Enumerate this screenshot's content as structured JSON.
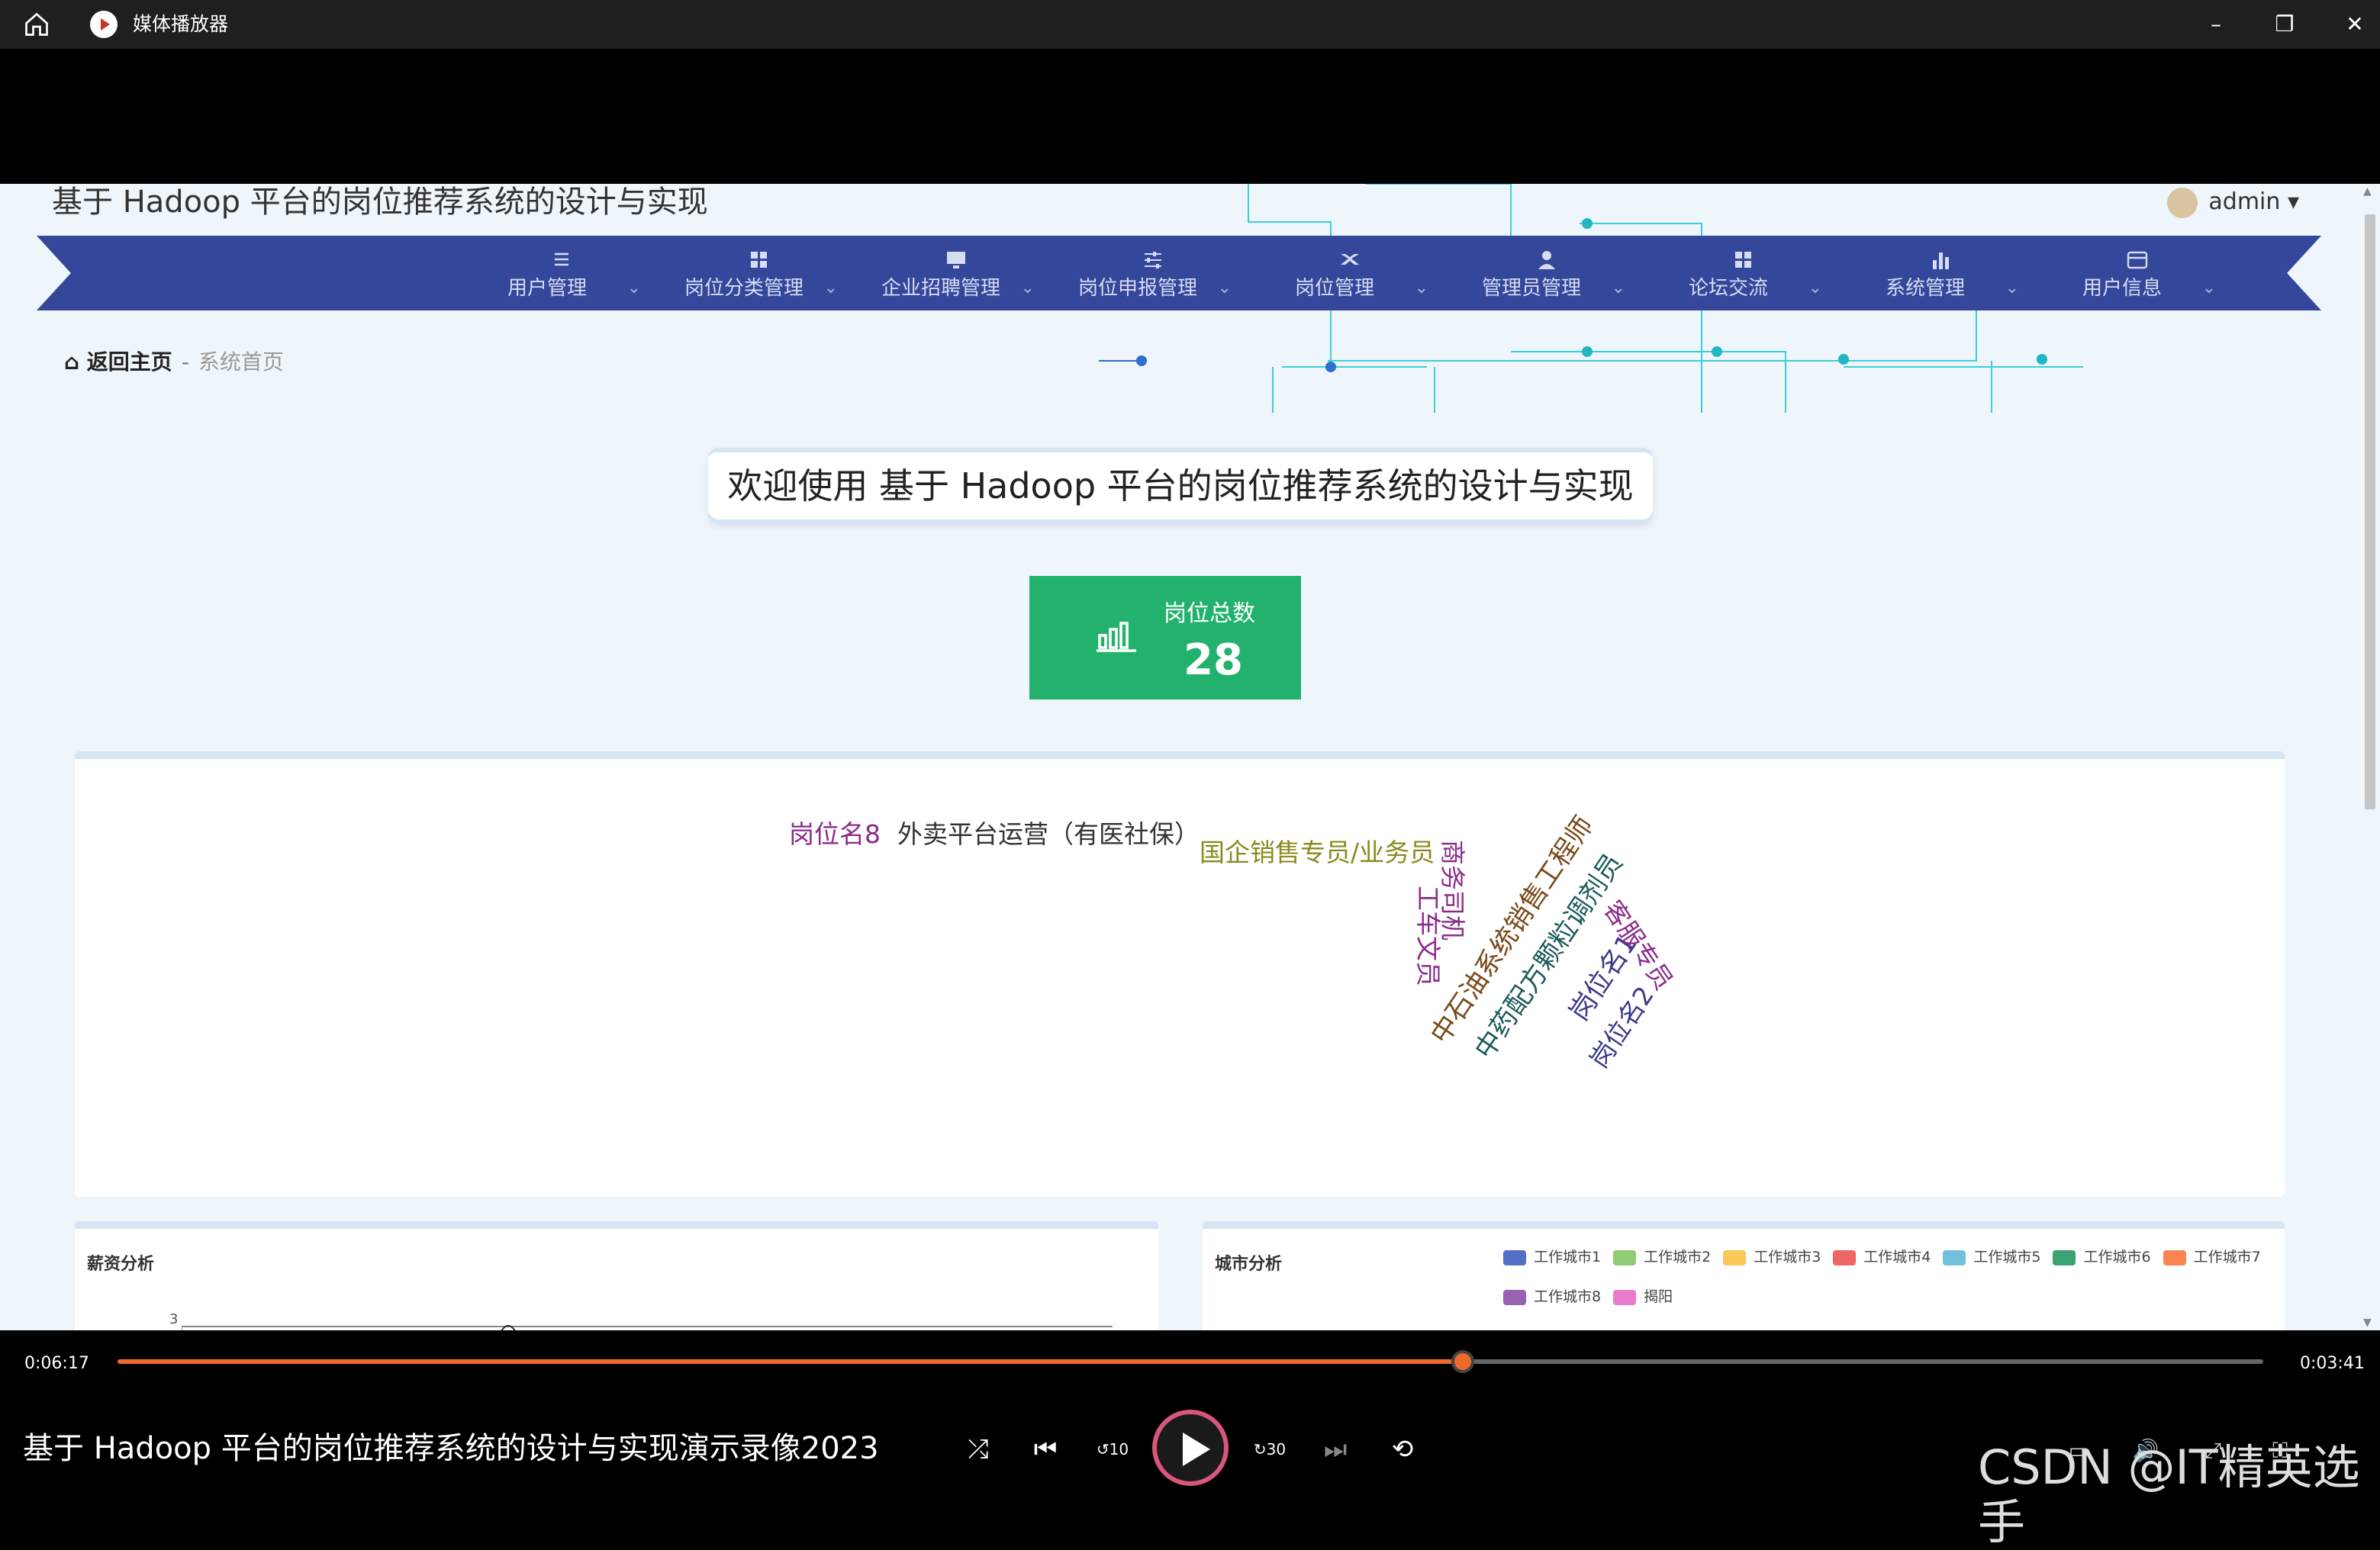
{
  "window": {
    "title": "媒体播放器"
  },
  "site": {
    "title": "基于 Hadoop 平台的岗位推荐系统的设计与实现",
    "user": "admin ▾",
    "nav": [
      {
        "label": "用户管理",
        "icon": "list-icon"
      },
      {
        "label": "岗位分类管理",
        "icon": "grid-icon"
      },
      {
        "label": "企业招聘管理",
        "icon": "monitor-icon"
      },
      {
        "label": "岗位申报管理",
        "icon": "sliders-icon"
      },
      {
        "label": "岗位管理",
        "icon": "plane-icon"
      },
      {
        "label": "管理员管理",
        "icon": "user-icon"
      },
      {
        "label": "论坛交流",
        "icon": "grid-icon"
      },
      {
        "label": "系统管理",
        "icon": "bar-chart-icon"
      },
      {
        "label": "用户信息",
        "icon": "card-icon"
      }
    ],
    "breadcrumb": {
      "home": "返回主页",
      "sep": "-",
      "current": "系统首页"
    },
    "welcome": "欢迎使用 基于 Hadoop 平台的岗位推荐系统的设计与实现",
    "stat": {
      "label": "岗位总数",
      "value": "28"
    },
    "wordcloud": [
      {
        "text": "岗位名8",
        "color": "#8b2a8b"
      },
      {
        "text": "外卖平台运营（有医社保）",
        "color": "#333333"
      },
      {
        "text": "国企销售专员/业务员",
        "color": "#8a8a1e"
      },
      {
        "text": "商务司机",
        "color": "#8b2a8b"
      },
      {
        "text": "工车文员",
        "color": "#8b2a8b"
      },
      {
        "text": "中石油系统销售工程师",
        "color": "#7a4a1a"
      },
      {
        "text": "中药配方颗粒调剂员",
        "color": "#1e5a5a"
      },
      {
        "text": "岗位名1",
        "color": "#3a3a8a"
      },
      {
        "text": "客服专员",
        "color": "#8b2a8b"
      },
      {
        "text": "岗位名2",
        "color": "#3a3a8a"
      }
    ],
    "salary_panel": {
      "title": "薪资分析",
      "tick": "3"
    },
    "city_panel": {
      "title": "城市分析",
      "legend": [
        {
          "label": "工作城市1",
          "color": "#5470c6"
        },
        {
          "label": "工作城市2",
          "color": "#91cc75"
        },
        {
          "label": "工作城市3",
          "color": "#fac858"
        },
        {
          "label": "工作城市4",
          "color": "#ee6666"
        },
        {
          "label": "工作城市5",
          "color": "#73c0de"
        },
        {
          "label": "工作城市6",
          "color": "#3ba272"
        },
        {
          "label": "工作城市7",
          "color": "#fc8452"
        },
        {
          "label": "工作城市8",
          "color": "#9a60b4"
        },
        {
          "label": "揭阳",
          "color": "#ea7ccc"
        }
      ]
    }
  },
  "player": {
    "elapsed": "0:06:17",
    "remaining": "0:03:41",
    "progress": 0.627,
    "video_title": "基于 Hadoop 平台的岗位推荐系统的设计与实现演示录像2023",
    "rewind_label": "10",
    "forward_label": "30",
    "watermark": "CSDN @IT精英选手",
    "accent": "#ef6a2a"
  }
}
